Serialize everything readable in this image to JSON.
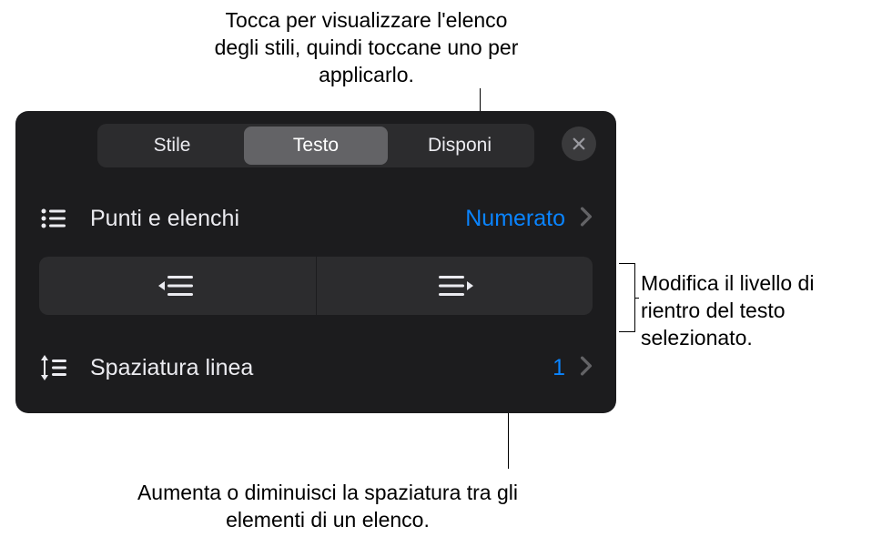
{
  "callouts": {
    "top": "Tocca per visualizzare l'elenco degli stili, quindi toccane uno per applicarlo.",
    "right": "Modifica il livello di rientro del testo selezionato.",
    "bottom": "Aumenta o diminuisci la spaziatura tra gli elementi di un elenco."
  },
  "tabs": {
    "style": "Stile",
    "text": "Testo",
    "arrange": "Disponi"
  },
  "rows": {
    "bullets": {
      "label": "Punti e elenchi",
      "value": "Numerato"
    },
    "lineSpacing": {
      "label": "Spaziatura linea",
      "value": "1"
    }
  },
  "colors": {
    "accent": "#0a84ff"
  }
}
